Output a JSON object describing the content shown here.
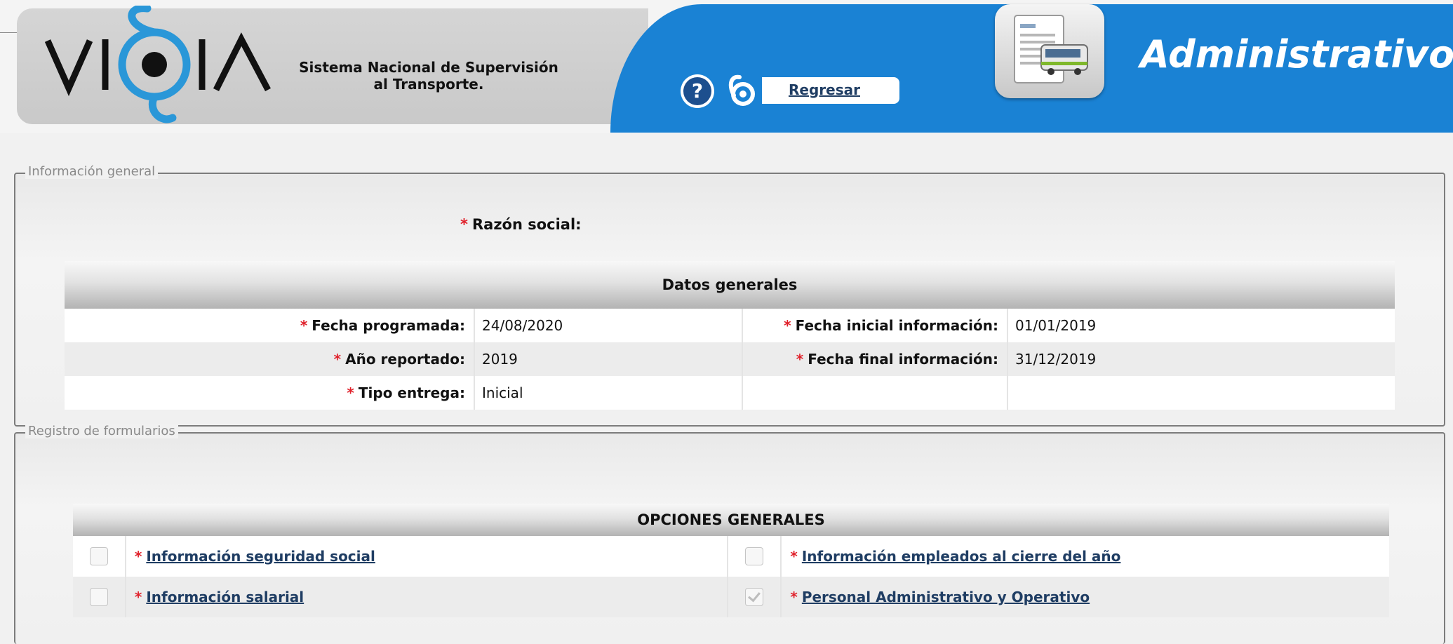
{
  "header": {
    "brand_line1": "Sistema Nacional de Supervisión",
    "brand_line2": "al Transporte.",
    "back_label": "Regresar",
    "app_title": "Administrativo",
    "colors": {
      "header_blue": "#1a82d4",
      "logo_blue": "#2a97d8",
      "link": "#1f3d63",
      "required": "#e0212b"
    }
  },
  "general": {
    "legend": "Información general",
    "razon_label": "Razón social:",
    "section_title": "Datos generales",
    "rows": [
      {
        "l1": "Fecha programada:",
        "v1": "24/08/2020",
        "l2": "Fecha inicial información:",
        "v2": "01/01/2019"
      },
      {
        "l1": "Año reportado:",
        "v1": "2019",
        "l2": "Fecha final información:",
        "v2": "31/12/2019"
      },
      {
        "l1": "Tipo entrega:",
        "v1": "Inicial"
      }
    ]
  },
  "forms": {
    "legend": "Registro de formularios",
    "section_title": "OPCIONES GENERALES",
    "options": [
      {
        "label": "Información seguridad social",
        "checked": false
      },
      {
        "label": "Información empleados al cierre del año",
        "checked": false
      },
      {
        "label": "Información salarial",
        "checked": false
      },
      {
        "label": "Personal Administrativo y Operativo",
        "checked": true
      }
    ]
  },
  "icons": [
    "vigia-logo-icon",
    "help-icon",
    "vigia-mini-icon",
    "bus-document-icon"
  ]
}
